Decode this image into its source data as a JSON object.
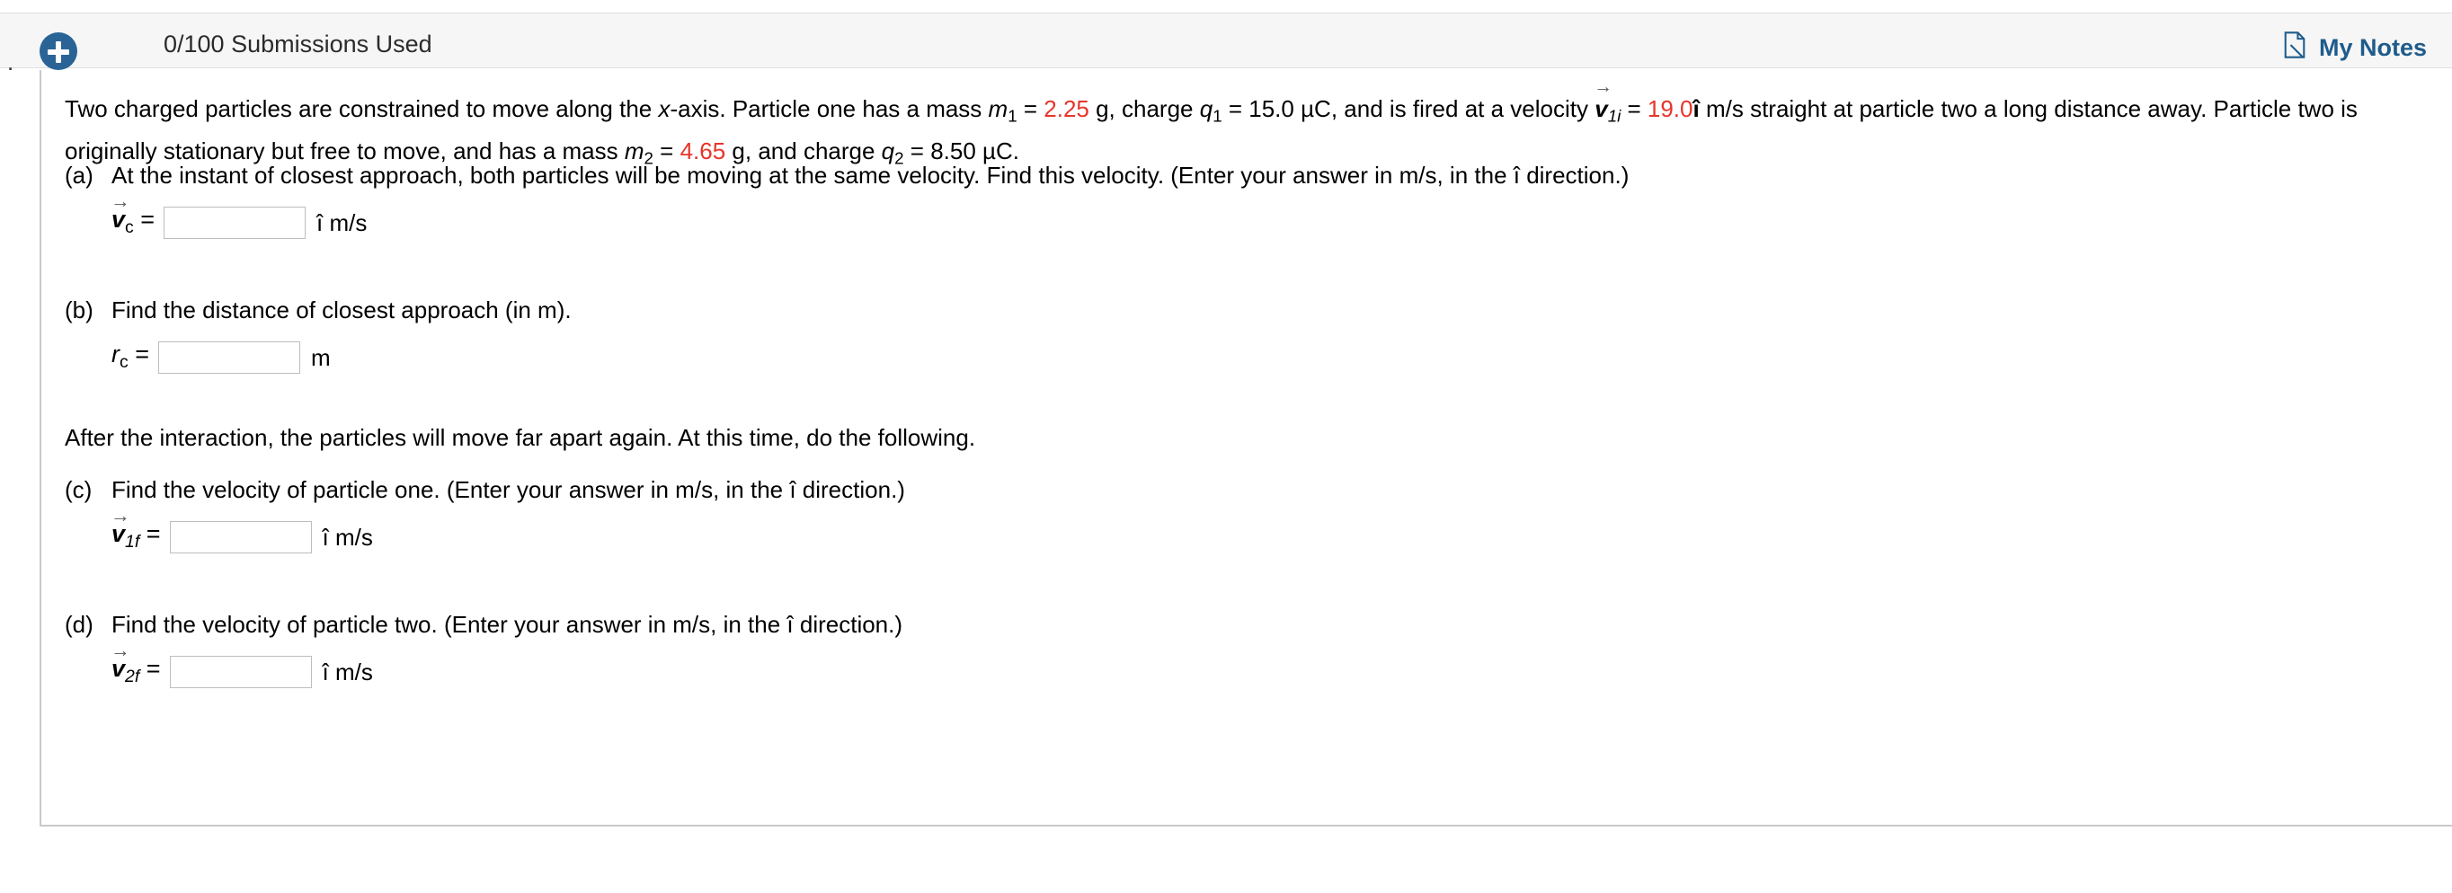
{
  "header": {
    "left_dot": ".",
    "add_icon": "plus-circle-icon",
    "submissions_label": "0/100 Submissions Used",
    "my_notes_label": "My Notes",
    "my_notes_icon": "note-page-icon",
    "accent_color": "#1f5c8b",
    "button_color": "#2a6496",
    "bar_background": "#f6f6f6"
  },
  "problem": {
    "text_part_1": "Two charged particles are constrained to move along the ",
    "x_axis": "x",
    "text_part_2": "-axis. Particle one has a mass ",
    "m1_symbol": "m",
    "m1_sub": "1",
    "eq1": " = ",
    "m1_value": "2.25",
    "m1_unit": " g, charge ",
    "q1_symbol": "q",
    "q1_sub": "1",
    "eq2": " = ",
    "q1_value": "15.0 µC",
    "text_part_3": ", and is fired at a velocity ",
    "v1i_symbol": "v",
    "v1i_sub": "1i",
    "eq3": " = ",
    "v1i_value": "19.0",
    "v1i_hat": "î",
    "text_part_4": " m/s straight at particle two a long distance away. Particle two is originally stationary but free to move, and has a mass ",
    "m2_symbol": "m",
    "m2_sub": "2",
    "eq4": " = ",
    "m2_value": "4.65",
    "m2_unit": " g, and charge ",
    "q2_symbol": "q",
    "q2_sub": "2",
    "eq5": " = ",
    "q2_value": "8.50 µC",
    "text_end": ".",
    "red_value_color": "#e8342a"
  },
  "parts": {
    "a": {
      "letter": "(a)",
      "prompt": "At the instant of closest approach, both particles will be moving at the same velocity. Find this velocity. (Enter your answer in m/s, in the î direction.)",
      "symbol": "v",
      "subscript": "c",
      "arrow": "→",
      "equals": "=",
      "input_value": "",
      "input_placeholder": "",
      "unit": "î m/s"
    },
    "b": {
      "letter": "(b)",
      "prompt": "Find the distance of closest approach (in m).",
      "symbol": "r",
      "subscript": "c",
      "equals": "=",
      "input_value": "",
      "input_placeholder": "",
      "unit": "m"
    },
    "after_text": "After the interaction, the particles will move far apart again. At this time, do the following.",
    "c": {
      "letter": "(c)",
      "prompt": "Find the velocity of particle one. (Enter your answer in m/s, in the î direction.)",
      "symbol": "v",
      "subscript": "1f",
      "arrow": "→",
      "equals": "=",
      "input_value": "",
      "input_placeholder": "",
      "unit": "î m/s"
    },
    "d": {
      "letter": "(d)",
      "prompt": "Find the velocity of particle two. (Enter your answer in m/s, in the î direction.)",
      "symbol": "v",
      "subscript": "2f",
      "arrow": "→",
      "equals": "=",
      "input_value": "",
      "input_placeholder": "",
      "unit": "î m/s"
    }
  }
}
